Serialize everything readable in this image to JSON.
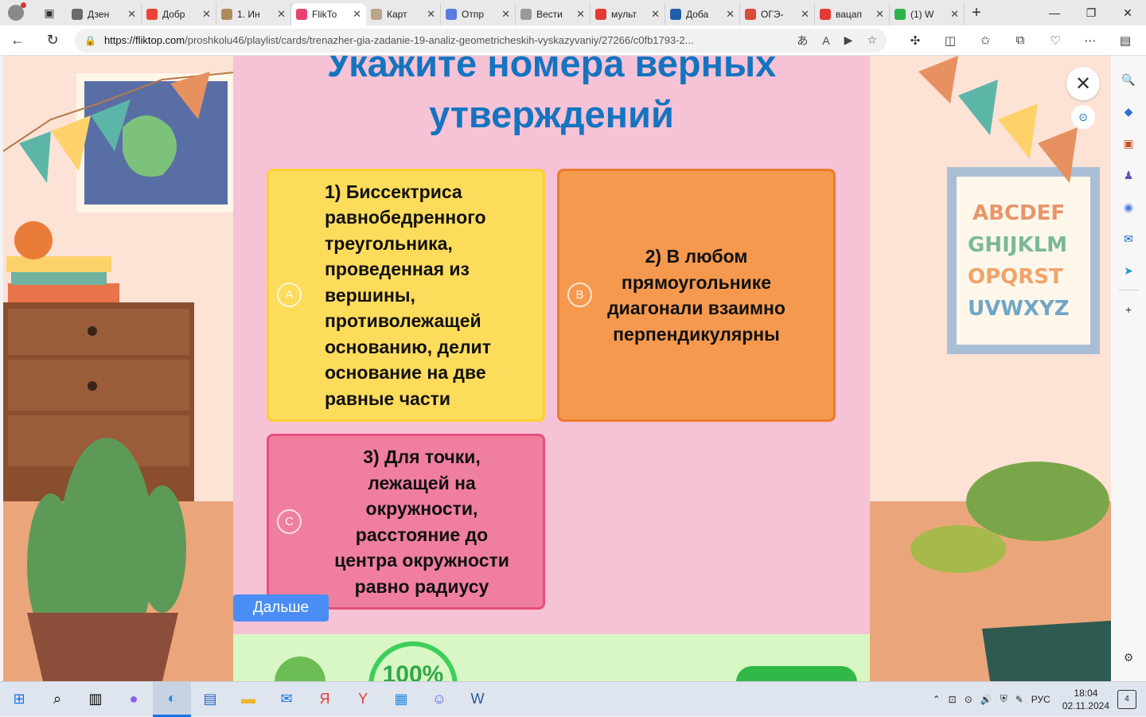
{
  "browser": {
    "tabs": [
      {
        "label": "Дзен",
        "color": "#6b6b6b",
        "active": false
      },
      {
        "label": "Добр",
        "color": "#ea4335",
        "active": false
      },
      {
        "label": "1. Ин",
        "color": "#b08a5a",
        "active": false
      },
      {
        "label": "FlikTo",
        "color": "#e8436e",
        "active": true
      },
      {
        "label": "Карт",
        "color": "#b9a58a",
        "active": false
      },
      {
        "label": "Отпр",
        "color": "#5a7be0",
        "active": false
      },
      {
        "label": "Вести",
        "color": "#9a9a9a",
        "active": false
      },
      {
        "label": "мульт",
        "color": "#e53935",
        "active": false
      },
      {
        "label": "Доба",
        "color": "#1f5fa8",
        "active": false
      },
      {
        "label": "ОГЭ-",
        "color": "#d84b3a",
        "active": false
      },
      {
        "label": "вацап",
        "color": "#e53935",
        "active": false
      },
      {
        "label": "(1) W",
        "color": "#2db34a",
        "active": false
      }
    ],
    "url_host": "https://fliktop.com",
    "url_path": "/proshkolu46/playlist/cards/trenazher-gia-zadanie-19-analiz-geometricheskih-vyskazyvaniy/27266/c0fb1793-2..."
  },
  "quiz": {
    "title": "Укажите номера верных утверждений",
    "cards": [
      {
        "letter": "A",
        "text": "1) Биссектриса равнобедренного треугольника, проведенная из вершины, противолежащей основанию, делит основание на две равные части"
      },
      {
        "letter": "B",
        "text": "2) В любом прямоугольнике диагонали взаимно перпендикулярны"
      },
      {
        "letter": "C",
        "text": "3) Для точки, лежащей на окружности, расстояние до центра окружности равно радиусу"
      }
    ],
    "next_label": "Дальше",
    "promo_percent": "100%"
  },
  "taskbar": {
    "lang": "РУС",
    "time": "18:04",
    "date": "02.11.2024",
    "notifications": "4"
  },
  "colors": {
    "title": "#1474bf",
    "card_a": "#fddc5c",
    "card_b": "#f5994f",
    "card_c": "#f07e9f",
    "next_button": "#4a8ef5"
  }
}
